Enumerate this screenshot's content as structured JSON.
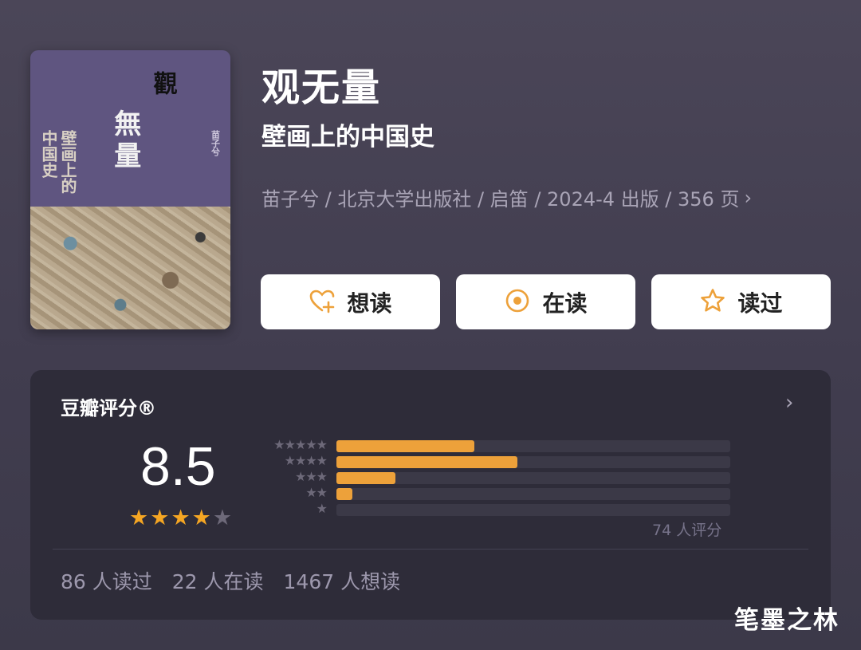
{
  "book": {
    "title": "观无量",
    "subtitle": "壁画上的中国史",
    "meta": "苗子兮 / 北京大学出版社 / 启笛 / 2024-4 出版 / 356 页",
    "meta_chevron": "›",
    "cover": {
      "guan": "觀",
      "wu": "無量",
      "sub1": "壁画上的",
      "sub2": "中国史",
      "author": "苗子兮"
    }
  },
  "actions": {
    "want_label": "想读",
    "reading_label": "在读",
    "read_label": "读过"
  },
  "rating": {
    "header": "豆瓣评分®",
    "chevron": "›",
    "score": "8.5",
    "stars": 4,
    "star_glyph": "★",
    "count_text": "74 人评分",
    "distribution": [
      {
        "stars": "★★★★★",
        "fraction": 0.35
      },
      {
        "stars": "★★★★",
        "fraction": 0.46
      },
      {
        "stars": "★★★",
        "fraction": 0.15
      },
      {
        "stars": "★★",
        "fraction": 0.04
      },
      {
        "stars": "★",
        "fraction": 0.0
      }
    ]
  },
  "stats": {
    "read": "86 人读过",
    "reading": "22 人在读",
    "want": "1467 人想读"
  },
  "colors": {
    "accent": "#eda13a",
    "star": "#f5a623",
    "card_bg": "#2e2c39"
  },
  "watermark": "笔墨之林"
}
